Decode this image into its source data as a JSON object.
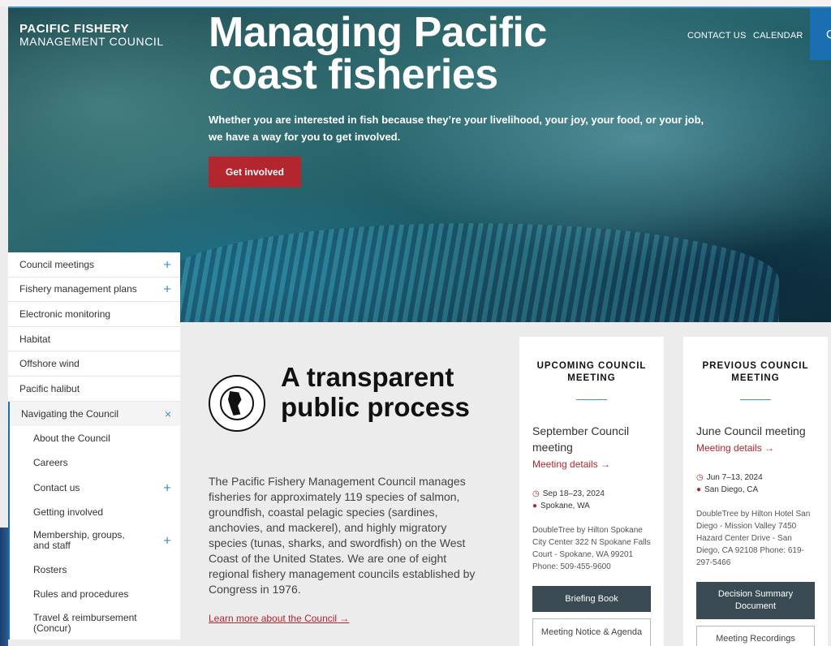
{
  "site": {
    "logo_line1": "PACIFIC FISHERY",
    "logo_line2": "MANAGEMENT COUNCIL"
  },
  "nav": {
    "contact": "CONTACT US",
    "calendar": "CALENDAR",
    "search_glyph": "Q"
  },
  "hero": {
    "title": "Managing Pacific coast fisheries",
    "subtitle": "Whether you are interested in fish because they’re your livelihood, your joy, your food, or your job, we have a way for you to get involved.",
    "cta": "Get involved"
  },
  "sidebar": {
    "items": [
      {
        "label": "Council meetings",
        "icon": "+"
      },
      {
        "label": "Fishery management plans",
        "icon": "+"
      },
      {
        "label": "Electronic monitoring",
        "icon": ""
      },
      {
        "label": "Habitat",
        "icon": ""
      },
      {
        "label": "Offshore wind",
        "icon": ""
      },
      {
        "label": "Pacific halibut",
        "icon": ""
      },
      {
        "label": "Navigating the Council",
        "icon": "×"
      }
    ],
    "subitems": [
      {
        "label": "About the Council",
        "icon": ""
      },
      {
        "label": "Careers",
        "icon": ""
      },
      {
        "label": "Contact us",
        "icon": "+"
      },
      {
        "label": "Getting involved",
        "icon": ""
      },
      {
        "label": "Membership, groups, and staff",
        "icon": "+"
      },
      {
        "label": "Rosters",
        "icon": ""
      },
      {
        "label": "Rules and procedures",
        "icon": ""
      },
      {
        "label": "Travel & reimbursement (Concur)",
        "icon": ""
      }
    ]
  },
  "about": {
    "title": "A transparent public process",
    "body": "The Pacific Fishery Management Council manages fisheries for approximately 119 species of salmon, groundfish, coastal pelagic species (sardines, anchovies, and mackerel), and highly migratory species (tunas, sharks, and swordfish) on the West Coast of the United States. We are one of eight regional fishery management councils established by Congress in 1976.",
    "link": "Learn more about the Council →"
  },
  "upcoming": {
    "heading": "UPCOMING COUNCIL MEETING",
    "title": "September Council meeting",
    "link": "Meeting details →",
    "date": "Sep 18–23, 2024",
    "location": "Spokane, WA",
    "address": "DoubleTree by Hilton Spokane City Center 322 N Spokane Falls Court - Spokane, WA 99201 Phone: 509-455-9600",
    "button1": "Briefing Book",
    "button2": "Meeting Notice & Agenda"
  },
  "previous": {
    "heading": "PREVIOUS COUNCIL MEETING",
    "title": "June Council meeting",
    "link": "Meeting details →",
    "date": "Jun 7–13, 2024",
    "location": "San Diego, CA",
    "address": "DoubleTree by Hilton Hotel San Diego - Mission Valley 7450 Hazard Center Drive - San Diego, CA 92108 Phone: 619-297-5466",
    "button1": "Decision Summary Document",
    "button2": "Meeting Recordings"
  },
  "icons": {
    "clock": "clock-icon",
    "pin": "map-pin-icon",
    "plus": "plus-icon",
    "close": "close-icon"
  },
  "colors": {
    "accent_red": "#b3262e",
    "accent_blue": "#1a6fb0",
    "dark_button": "#3a4a52"
  }
}
